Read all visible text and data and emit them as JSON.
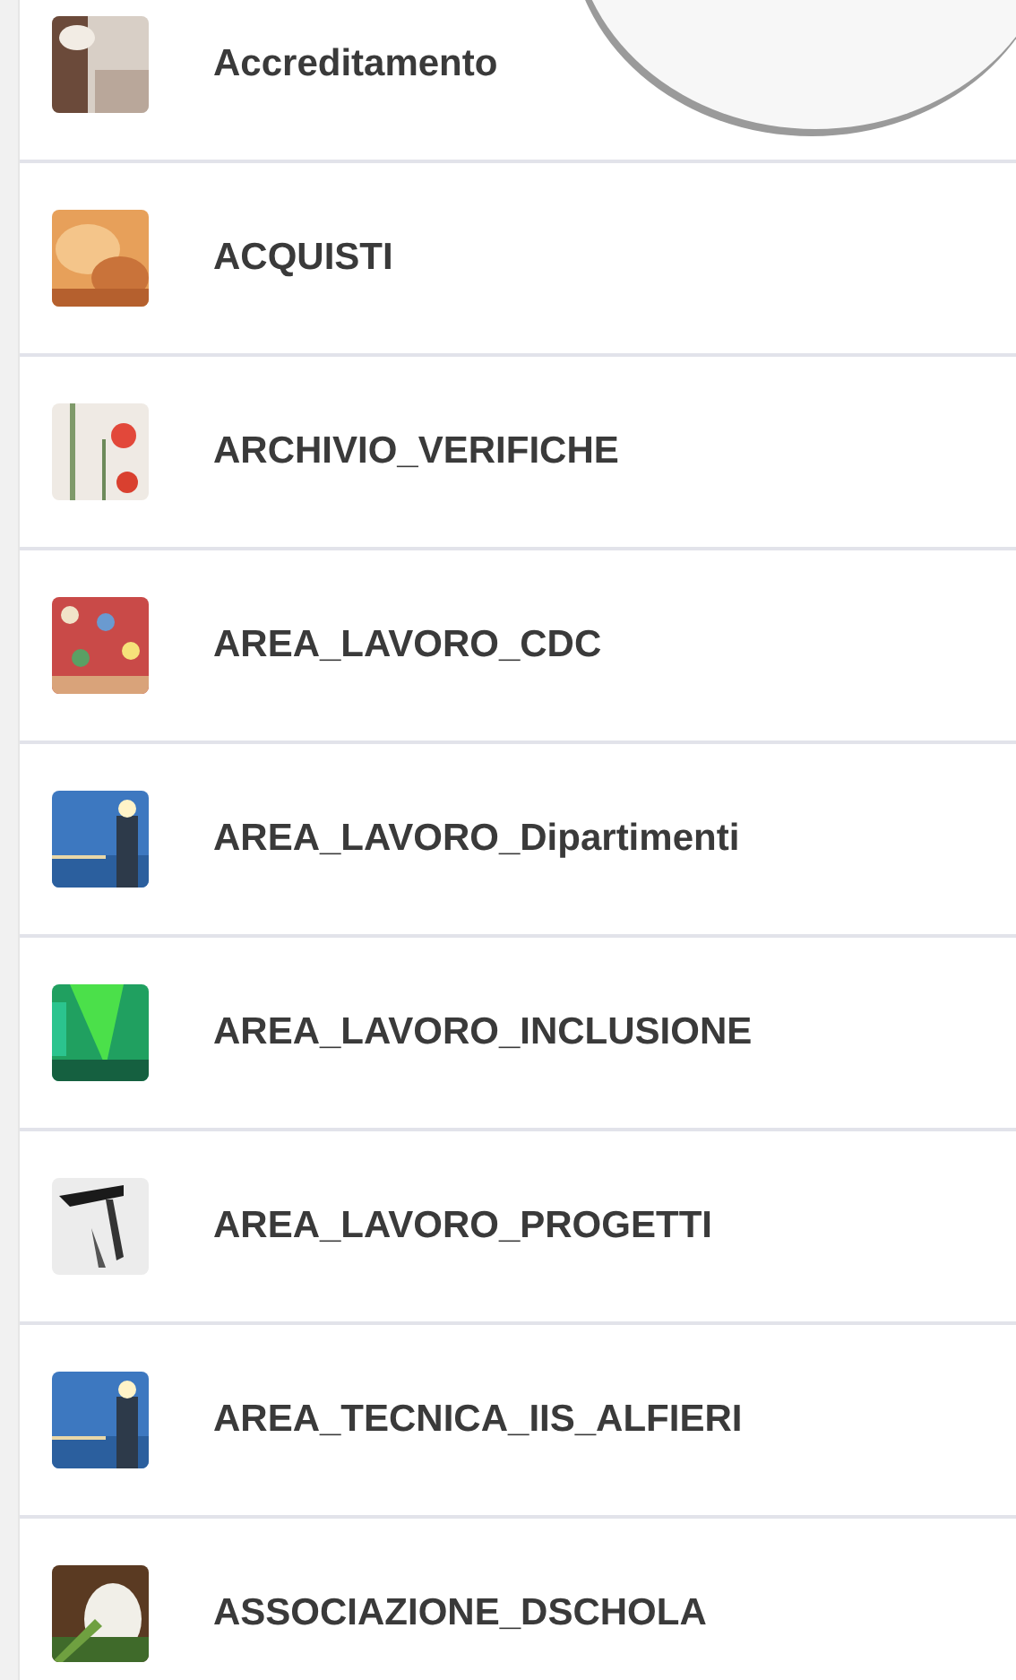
{
  "items": [
    {
      "label": "Accreditamento"
    },
    {
      "label": "ACQUISTI"
    },
    {
      "label": "ARCHIVIO_VERIFICHE"
    },
    {
      "label": "AREA_LAVORO_CDC"
    },
    {
      "label": "AREA_LAVORO_Dipartimenti"
    },
    {
      "label": "AREA_LAVORO_INCLUSIONE"
    },
    {
      "label": "AREA_LAVORO_PROGETTI"
    },
    {
      "label": "AREA_TECNICA_IIS_ALFIERI"
    },
    {
      "label": "ASSOCIAZIONE_DSCHOLA"
    }
  ]
}
